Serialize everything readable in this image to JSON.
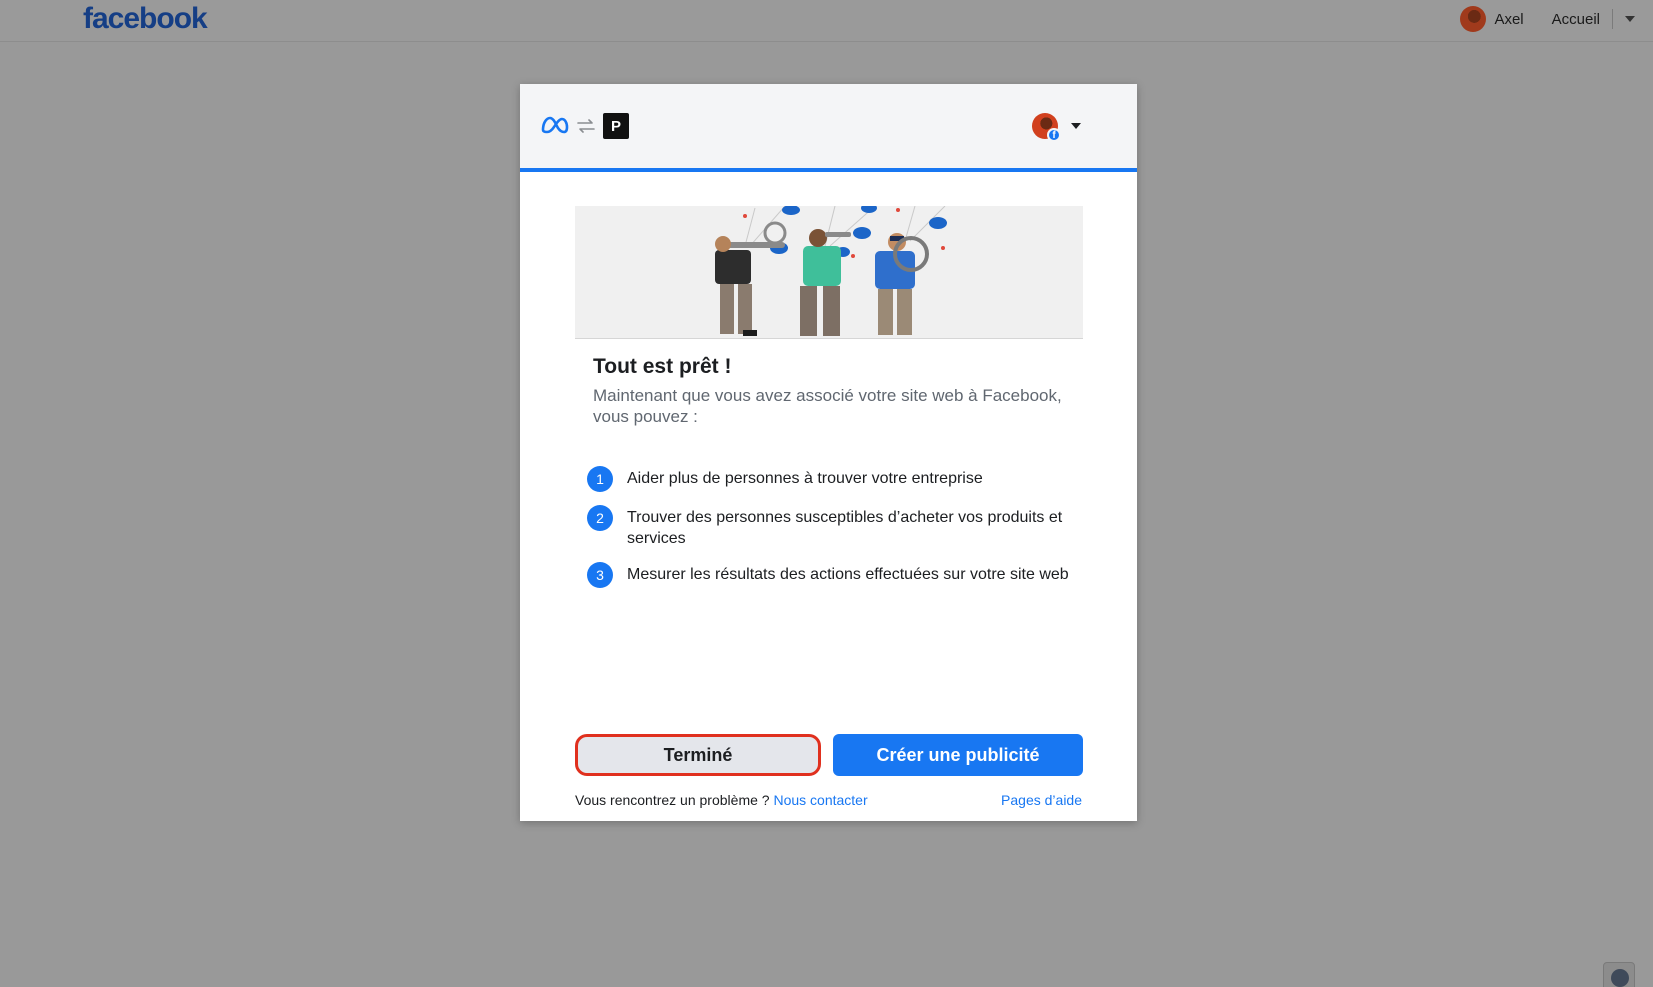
{
  "topbar": {
    "logo": "facebook",
    "user_name": "Axel",
    "home_label": "Accueil"
  },
  "modal": {
    "header": {
      "badge_letter": "P",
      "fb_badge": "f"
    },
    "title": "Tout est prêt !",
    "subtitle": "Maintenant que vous avez associé votre site web à Facebook, vous pouvez :",
    "steps": [
      {
        "num": "1",
        "text": "Aider plus de personnes à trouver votre entreprise"
      },
      {
        "num": "2",
        "text": "Trouver des personnes susceptibles d’acheter vos produits et services"
      },
      {
        "num": "3",
        "text": "Mesurer les résultats des actions effectuées sur votre site web"
      }
    ],
    "buttons": {
      "done_label": "Terminé",
      "create_ad_label": "Créer une publicité"
    },
    "footer": {
      "problem_text": "Vous rencontrez un problème ?",
      "contact_link": "Nous contacter",
      "help_link": "Pages d’aide"
    }
  },
  "colors": {
    "accent": "#1877f2",
    "highlight": "#e0301e",
    "overlay": "#999999"
  },
  "icons": {
    "meta_logo": "meta-icon",
    "swap": "swap-arrows-icon",
    "globe": "globe-icon"
  }
}
